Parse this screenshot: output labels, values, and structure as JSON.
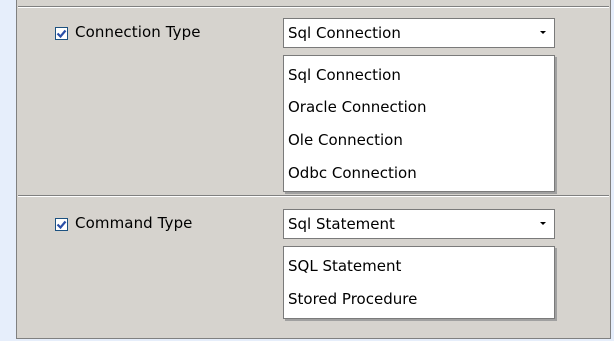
{
  "connection": {
    "label": "Connection Type",
    "checked": true,
    "selected": "Sql Connection",
    "options": [
      "Sql Connection",
      "Oracle Connection",
      "Ole Connection",
      "Odbc Connection"
    ]
  },
  "command": {
    "label": "Command Type",
    "checked": true,
    "selected": "Sql Statement",
    "options": [
      "SQL Statement",
      "Stored Procedure"
    ]
  },
  "colors": {
    "panel": "#d6d3ce",
    "background": "#e6eefb",
    "checkmark": "#2a4fa8"
  }
}
